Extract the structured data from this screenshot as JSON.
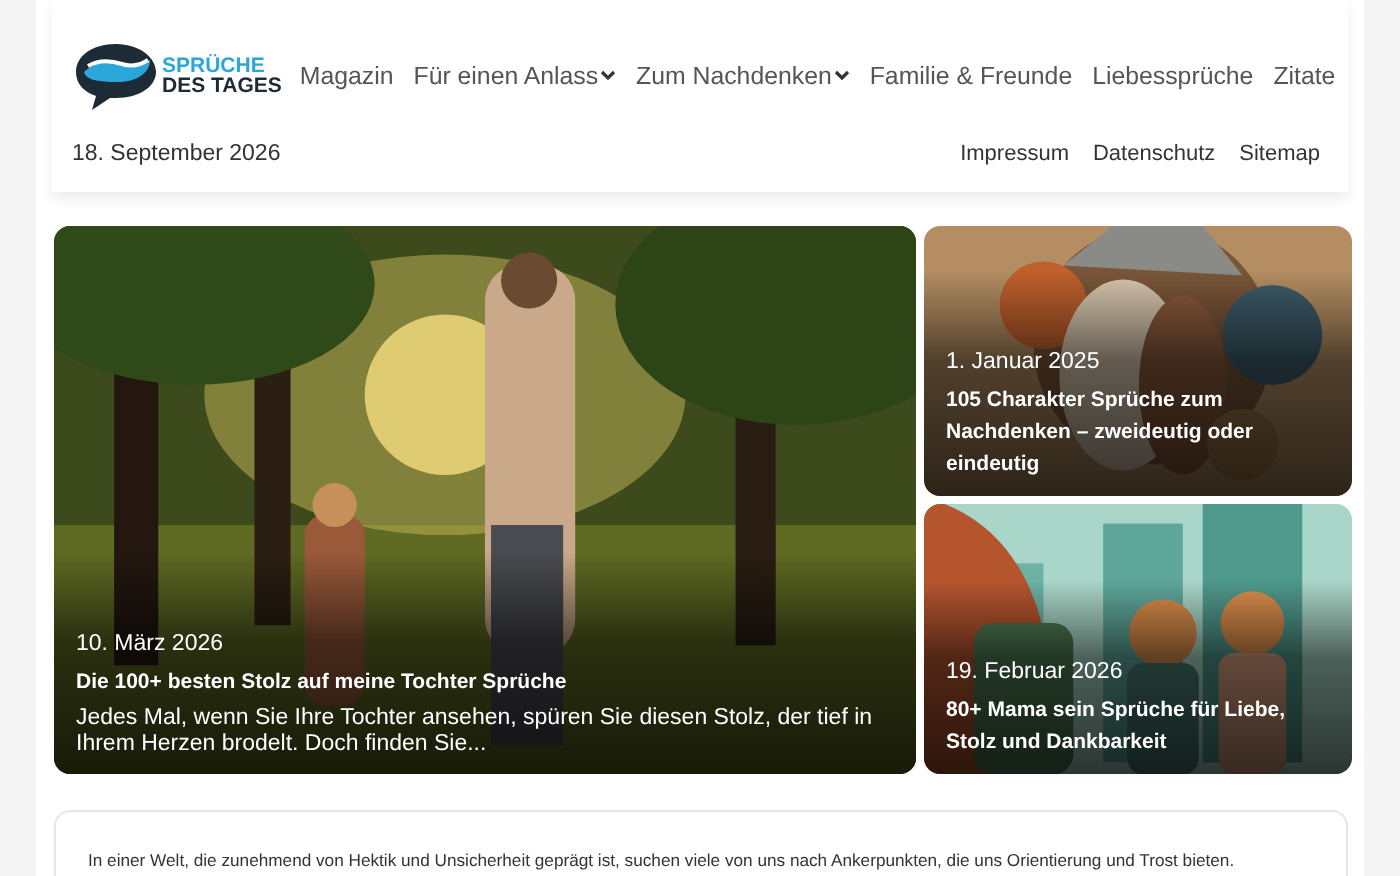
{
  "logo": {
    "line_1": "SPRÜCHE",
    "line_2": "DES TAGES"
  },
  "nav": [
    {
      "label": "Magazin",
      "dropdown": false
    },
    {
      "label": "Für einen Anlass",
      "dropdown": true
    },
    {
      "label": "Zum Nachdenken",
      "dropdown": true
    },
    {
      "label": "Familie & Freunde",
      "dropdown": false
    },
    {
      "label": "Liebessprüche",
      "dropdown": false
    },
    {
      "label": "Zitate",
      "dropdown": false
    }
  ],
  "date": "18. September 2026",
  "meta_links": [
    "Impressum",
    "Datenschutz",
    "Sitemap"
  ],
  "featured": [
    {
      "kind": "picture",
      "date": "10. März 2026",
      "title": "Die 100+ besten Stolz auf meine Tochter Sprüche",
      "excerpt": "Jedes Mal, wenn Sie Ihre Tochter ansehen, spüren Sie diesen Stolz, der tief in Ihrem Herzen brodelt. Doch finden Sie..."
    },
    {
      "kind": "picture",
      "date": "1. Januar 2025",
      "title": "105 Charakter Sprüche zum Nachdenken – zweideutig oder eindeutig"
    },
    {
      "kind": "picture",
      "date": "19. Februar 2026",
      "title": "80+ Mama sein Sprüche für Liebe, Stolz und Dankbarkeit"
    }
  ],
  "intro": "In einer Welt, die zunehmend von Hektik und Unsicherheit geprägt ist, suchen viele von uns nach Ankerpunkten, die uns Orientierung und Trost bieten."
}
